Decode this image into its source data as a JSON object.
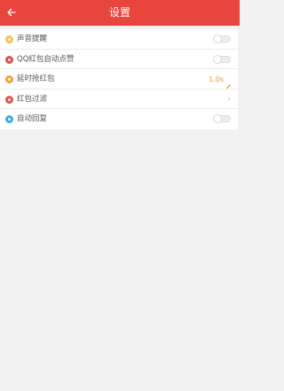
{
  "header": {
    "title": "设置",
    "back_icon": "arrow-left-icon"
  },
  "colors": {
    "header_bg": "#e8453c",
    "page_bg": "#f1f1f1",
    "accent_value": "#e0a330"
  },
  "settings": {
    "items": [
      {
        "label": "声音提醒",
        "icon": "sound-icon",
        "icon_color": "#f2c54f",
        "control": "toggle",
        "enabled": false
      },
      {
        "label": "QQ红包自动点赞",
        "icon": "qq-like-icon",
        "icon_color": "#d9534f",
        "control": "toggle",
        "enabled": false
      },
      {
        "label": "延时抢红包",
        "icon": "delay-icon",
        "icon_color": "#f0a33a",
        "control": "value",
        "value": "1.0s",
        "edit_icon": "pencil-icon"
      },
      {
        "label": "红包过滤",
        "icon": "filter-icon",
        "icon_color": "#e2554d",
        "control": "chevron",
        "chevron_icon": "chevron-right-icon",
        "chevron_glyph": "›"
      },
      {
        "label": "自动回复",
        "icon": "auto-reply-icon",
        "icon_color": "#3aaee0",
        "control": "toggle",
        "enabled": false
      }
    ]
  }
}
